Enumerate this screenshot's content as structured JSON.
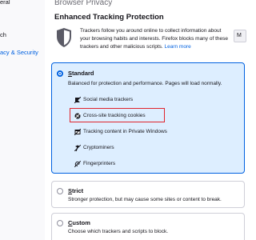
{
  "sidebar": {
    "items": [
      {
        "label": "General",
        "visible_label": "eral",
        "active": false
      },
      {
        "label": "Search",
        "visible_label": "ch",
        "active": false
      },
      {
        "label": "Privacy & Security",
        "visible_label": "acy & Security",
        "active": true
      }
    ]
  },
  "page": {
    "title": "Browser Privacy"
  },
  "etp": {
    "heading": "Enhanced Tracking Protection",
    "description": "Trackers follow you around online to collect information about your browsing habits and interests. Firefox blocks many of these trackers and other malicious scripts.",
    "learn_more": "Learn more",
    "manage_label": "M"
  },
  "options": {
    "standard": {
      "title_first": "S",
      "title_rest": "tandard",
      "description": "Balanced for protection and performance. Pages will load normally.",
      "selected": true,
      "trackers": [
        {
          "label": "Social media trackers",
          "icon": "social-tracker-icon"
        },
        {
          "label": "Cross-site tracking cookies",
          "icon": "cookie-icon",
          "highlighted": true
        },
        {
          "label": "Tracking content in Private Windows",
          "icon": "tracking-content-icon"
        },
        {
          "label": "Cryptominers",
          "icon": "cryptominer-icon"
        },
        {
          "label": "Fingerprinters",
          "icon": "fingerprinter-icon"
        }
      ]
    },
    "strict": {
      "title_rest": "trict",
      "title_first": "S",
      "description": "Stronger protection, but may cause some sites or content to break.",
      "selected": false
    },
    "custom": {
      "title_first": "C",
      "title_rest": "ustom",
      "description": "Choose which trackers and scripts to block.",
      "selected": false
    }
  },
  "colors": {
    "accent": "#0061e0",
    "selected_card_bg": "#ddeeff",
    "highlight_red": "#e0242c"
  }
}
